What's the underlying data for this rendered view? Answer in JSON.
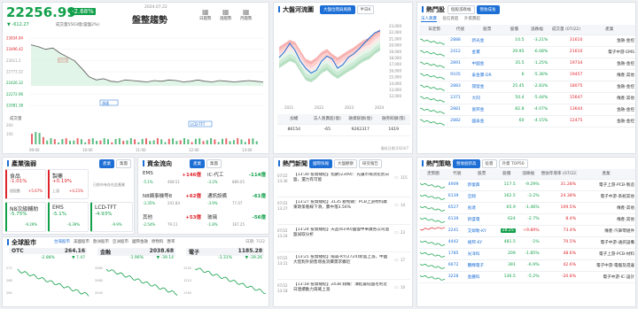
{
  "index": {
    "value": "22256.99",
    "change": "▼ -612.27",
    "pct": "-2.68%",
    "volume": "成交量5503億(當盤2%)",
    "date": "2024.07.22",
    "trend": "盤整趨勢"
  },
  "ma_btns": [
    "日趨勢",
    "週趨勢",
    "月趨勢"
  ],
  "main_chart": {
    "prices": [
      23834.84,
      23496.42,
      23011.2,
      22773.22,
      22426.32,
      22272.96,
      22081.38
    ],
    "volume_title": "成交量",
    "vol_ticks": [
      "200",
      "100"
    ],
    "times": [
      "09:00",
      "10:00",
      "11:00",
      "12:00",
      "13:00"
    ],
    "tags": [
      "高點",
      "漲速",
      "LCD-TFT"
    ],
    "series": [
      0.05,
      0.08,
      0.12,
      0.1,
      0.18,
      0.24,
      0.3,
      0.42,
      0.55,
      0.6,
      0.58,
      0.62,
      0.63,
      0.6,
      0.61,
      0.62,
      0.63,
      0.61,
      0.62,
      0.6,
      0.61,
      0.63,
      0.62,
      0.6,
      0.62,
      0.63,
      0.61,
      0.62,
      0.63,
      0.62,
      0.61,
      0.62,
      0.63
    ]
  },
  "river": {
    "title": "大盤河流圖",
    "tabs": [
      "大盤位階與風險",
      "半日K"
    ],
    "years": [
      "2021",
      "2022",
      "2023",
      "2024"
    ],
    "yticks": [
      "23,000",
      "22,000",
      "21,000",
      "20,000",
      "19,000",
      "18,000",
      "17,000",
      "16,000",
      "15,000",
      "14,000",
      "13,000",
      "12,000"
    ],
    "headers": [
      "加權",
      "法人買賣超(億)",
      "融資餘額(億)",
      "融券餘額(張)"
    ],
    "row": [
      "86154",
      "-65",
      "9262317",
      "1619"
    ],
    "note": "資料日期:2024/7",
    "band": [
      0.35,
      0.3,
      0.25,
      0.28,
      0.4,
      0.52,
      0.55,
      0.5,
      0.42,
      0.38,
      0.45,
      0.5,
      0.45,
      0.4,
      0.36,
      0.3,
      0.25,
      0.22,
      0.15,
      0.1
    ],
    "line": [
      0.4,
      0.32,
      0.2,
      0.3,
      0.45,
      0.55,
      0.62,
      0.58,
      0.45,
      0.38,
      0.42,
      0.55,
      0.5,
      0.4,
      0.35,
      0.28,
      0.2,
      0.12,
      0.05,
      0.02
    ]
  },
  "hot_stocks": {
    "title": "熱門股",
    "tabs": [
      "個股漲跌幅",
      "營收成長"
    ],
    "subtabs": [
      "法人買賣",
      "投信買超",
      "外資賣超"
    ],
    "headers": [
      "日走勢",
      "代號",
      "股票",
      "股價",
      "漲跌幅",
      "成交量\n(07/22)",
      "產業"
    ],
    "rows": [
      [
        "2888",
        "新光金",
        "10.5",
        "-3.21%",
        "31610",
        "金融-金控"
      ],
      [
        "2412",
        "金寶",
        "29.95",
        "-6.08%",
        "21610",
        "電子中游-EMS"
      ],
      [
        "2891",
        "中國金",
        "35.5",
        "-1.25%",
        "19734",
        "金融-金控"
      ],
      [
        "9105",
        "泰金寶-DR",
        "6",
        "-5.36%",
        "19457",
        "傳產-其他"
      ],
      [
        "2883",
        "開發金",
        "25.45",
        "-2.83%",
        "18075",
        "金融-金控"
      ],
      [
        "2371",
        "大同",
        "50.4",
        "-5.44%",
        "15647",
        "傳產-其他"
      ],
      [
        "2881",
        "富邦金",
        "82.8",
        "-4.07%",
        "13644",
        "金融-金控"
      ],
      [
        "2882",
        "國泰金",
        "60",
        "-4.15%",
        "12475",
        "金融-金控"
      ]
    ]
  },
  "industry": {
    "title": "產業強弱",
    "tabs": [
      "產業",
      "集團"
    ],
    "cards": [
      {
        "name": "食品",
        "pct": "-1.01%",
        "sub1": "個股數",
        "sub1v": "+5.67%",
        "up": "上漲",
        "upv": "+4.21%"
      },
      {
        "name": "製藥",
        "pct": "+0.19%",
        "sub1": "",
        "sub1v": "",
        "up": "",
        "upv": ""
      },
      {
        "name": "N8次級輔助",
        "pct": "-5.75%",
        "sub1": "",
        "sub1v": "-9.29%",
        "up": "",
        "upv": ""
      },
      {
        "name": "EMS",
        "pct": "-5.1%",
        "sub1": "",
        "sub1v": "-6.39%",
        "up": "",
        "upv": ""
      },
      {
        "name": "LCD-TFT",
        "pct": "-4.93%",
        "sub1": "",
        "sub1v": "-9.9%",
        "up": "",
        "upv": ""
      }
    ],
    "note": "日前市有存在此產業"
  },
  "capital": {
    "title": "資金流向",
    "tabs": [
      "產業",
      "集團"
    ],
    "items": [
      {
        "name": "EMS",
        "amt": "+146億",
        "a": "-5.1%",
        "b": "468.51"
      },
      {
        "name": "IC-代工",
        "amt": "-114億",
        "a": "-3.2%",
        "b": "889.05"
      },
      {
        "name": "N8網事機等8",
        "amt": "+62億",
        "a": "-3.35%",
        "b": "241.84"
      },
      {
        "name": "通訊設備",
        "amt": "-61億",
        "a": "-3.9%",
        "b": "77.07"
      },
      {
        "name": "其他",
        "amt": "+53億",
        "a": "-2.54%",
        "b": "79.11"
      },
      {
        "name": "玻璃",
        "amt": "-56億",
        "a": "-1.8%",
        "b": "167.25"
      }
    ]
  },
  "global": {
    "title": "全球股市",
    "tabs": [
      "台灣股市",
      "美國股市",
      "歐洲股市",
      "亞洲股市",
      "國際金融",
      "原物料",
      "匯率"
    ],
    "date": "日期: 7/22",
    "cards": [
      {
        "name": "OTC",
        "val": "264.16",
        "chg": "-2.88%",
        "pct": "▼ 7.47",
        "ticks": [
          "272",
          "268",
          "264"
        ]
      },
      {
        "name": "金融",
        "val": "2038.68",
        "chg": "-1.96%",
        "pct": "▼ -39.14",
        "ticks": [
          "2080",
          "2060",
          "2040"
        ]
      },
      {
        "name": "電子",
        "val": "1185.28",
        "chg": "-3.31%",
        "pct": "▼ -39.26",
        "ticks": [
          "1230",
          "1210",
          "1190"
        ]
      }
    ]
  },
  "news": {
    "title": "熱門新聞",
    "tabs": [
      "國際快報",
      "大盤觀察",
      "研究報告"
    ],
    "items": [
      {
        "date": "07/22",
        "time": "13:36",
        "text": "【13:30 投資總結】指數(2349)：先讓市場消化別日盤，還力有可能",
        "c": "115"
      },
      {
        "date": "07/22",
        "time": "13:27",
        "text": "【13:27 投資總結】3135 動物期：PCB上游材料廣東政策看線下滑，賣中落3.56%",
        "c": "14"
      },
      {
        "date": "07/22",
        "time": "13:24",
        "text": "【13:24 投資總結】天品(6190)國盤中華廣各公司過盤試取分析",
        "c": "23"
      },
      {
        "date": "07/22",
        "time": "13:21",
        "text": "【13:21 投資總結】陽森-KY(2724)新盛上漲，中國大陸對外銷售增長消費需求擴近",
        "c": "17"
      },
      {
        "date": "07/22",
        "time": "13:18",
        "text": "【13:18 投資總結】2438 翔耀：溝結最低盤毛利近日連續動力再確上漲",
        "c": "10"
      }
    ]
  },
  "strategy": {
    "title": "熱門策略",
    "tabs": [
      "營收創新高",
      "投資",
      "外資 TOP50"
    ],
    "headers": [
      "走勢圖",
      "代號",
      "股票",
      "股價",
      "漲跌幅",
      "營收年增率\n(07/22)",
      "產業"
    ],
    "rows": [
      [
        "4909",
        "新復興",
        "117.5",
        "-9.29%",
        "31.28%",
        "電子上游-PCB-製造"
      ],
      [
        "6139",
        "亞翔",
        "162.5",
        "-3.2%",
        "24.38%",
        "電子中游-系統其他"
      ],
      [
        "6527",
        "長達",
        "65.9",
        "-1.46%",
        "109.5%",
        "傳產-其他"
      ],
      [
        "6139",
        "新盛電",
        "624",
        "-2.7%",
        "8.4%",
        "傳產-其他"
      ],
      [
        "2241",
        "艾姆勒-KY",
        "28.25",
        "+9.89%",
        "73.4%",
        "傳產-汽車零組件"
      ],
      [
        "4442",
        "竣邦-KY",
        "481.5",
        "-1%",
        "70.5%",
        "電子中游-通訊設備"
      ],
      [
        "1785",
        "光洋科",
        "209",
        "-1.85%",
        "48.6%",
        "電子上游-PCB-材料"
      ],
      [
        "6672",
        "騰輝電子",
        "391",
        "-6.9%",
        "42.6%",
        "電子中游-電腦及週邊"
      ],
      [
        "3228",
        "金麗科",
        "136.5",
        "-5.2%",
        "-20.8%",
        "電子中游-IC-設計"
      ]
    ]
  }
}
